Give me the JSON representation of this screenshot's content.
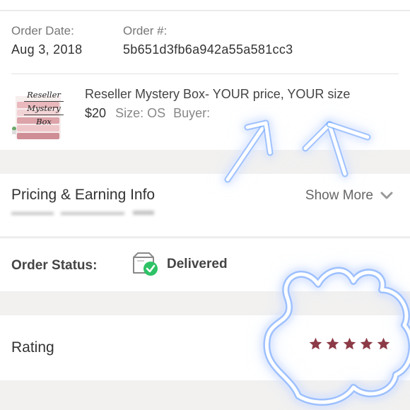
{
  "order": {
    "date_label": "Order Date:",
    "date_value": "Aug 3, 2018",
    "number_label": "Order #:",
    "number_value": "5b651d3fb6a942a55a581cc3"
  },
  "item": {
    "thumbnail_text": [
      "Reseller",
      "Mystery",
      "Box"
    ],
    "title": "Reseller Mystery Box- YOUR price, YOUR size",
    "price": "$20",
    "size": "Size: OS",
    "buyer": "Buyer:"
  },
  "pricing": {
    "title": "Pricing & Earning Info",
    "show_more": "Show More"
  },
  "status": {
    "label": "Order Status:",
    "value": "Delivered",
    "icon": "package-delivered-icon"
  },
  "rating": {
    "title": "Rating",
    "stars": 5,
    "max_stars": 5
  },
  "colors": {
    "star": "#8b3a46",
    "check": "#2ec266",
    "neon_glow": "#3b8cff"
  }
}
